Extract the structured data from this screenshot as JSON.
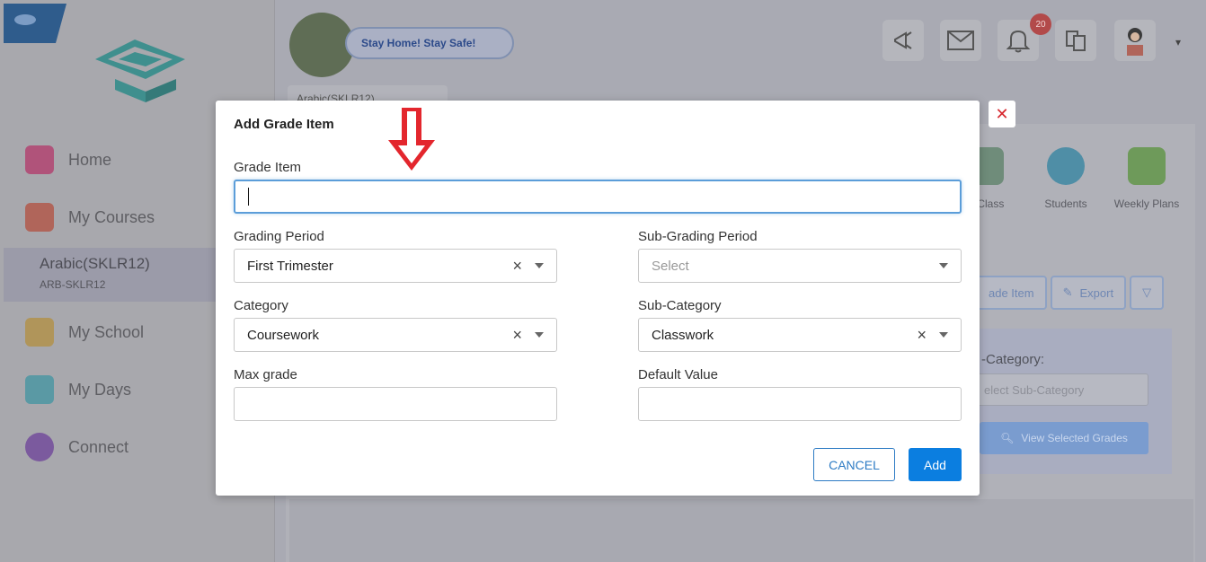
{
  "topbar": {
    "banner": "Stay Home! Stay Safe!",
    "notification_count": "20",
    "course_tab": "Arabic(SKLR12)"
  },
  "sidebar": {
    "items": [
      {
        "label": "Home",
        "icon": "home-icon",
        "color": "#b0537a"
      },
      {
        "label": "My Courses",
        "icon": "courses-icon",
        "color": "#b0655a"
      },
      {
        "label": "My School",
        "icon": "school-icon",
        "color": "#b0955a"
      },
      {
        "label": "My Days",
        "icon": "calendar-icon",
        "color": "#5a99a4"
      },
      {
        "label": "Connect",
        "icon": "connect-icon",
        "color": "#7b5a9e"
      }
    ],
    "active_course": {
      "name": "Arabic(SKLR12)",
      "code": "ARB-SKLR12"
    }
  },
  "background": {
    "quick_icons": [
      "al Class",
      "Students",
      "Weekly Plans"
    ],
    "buttons": [
      "ade Item",
      "Export"
    ],
    "filter_label": "-Category:",
    "filter_placeholder": "elect Sub-Category",
    "view_button": "View Selected Grades"
  },
  "modal": {
    "title": "Add Grade Item",
    "grade_item": {
      "label": "Grade Item",
      "value": ""
    },
    "grading_period": {
      "label": "Grading Period",
      "value": "First Trimester"
    },
    "sub_grading_period": {
      "label": "Sub-Grading Period",
      "placeholder": "Select"
    },
    "category": {
      "label": "Category",
      "value": "Coursework"
    },
    "sub_category": {
      "label": "Sub-Category",
      "value": "Classwork"
    },
    "max_grade": {
      "label": "Max grade",
      "value": ""
    },
    "default_value": {
      "label": "Default Value",
      "value": ""
    },
    "cancel_label": "CANCEL",
    "add_label": "Add",
    "close_glyph": "✕"
  },
  "colors": {
    "primary": "#0b7ee0",
    "annotation_arrow": "#e3262d",
    "close": "#d7282f"
  }
}
